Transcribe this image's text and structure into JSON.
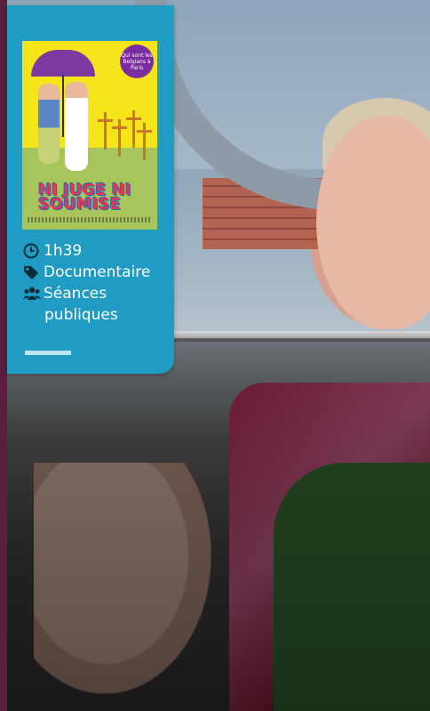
{
  "poster": {
    "title": "NI JUGE NI SOUMISE",
    "badge_text": "Qui sont les Belgians à Paris"
  },
  "meta": {
    "duration": "1h39",
    "genre": "Documentaire",
    "screening_line1": "Séances",
    "screening_line2": "publiques"
  },
  "colors": {
    "card_bg": "#1f9bc4",
    "accent_bar": "#bfe7f3",
    "poster_yellow": "#f3e51a"
  },
  "icons": {
    "duration": "clock-icon",
    "genre": "tag-icon",
    "screening": "group-icon"
  }
}
